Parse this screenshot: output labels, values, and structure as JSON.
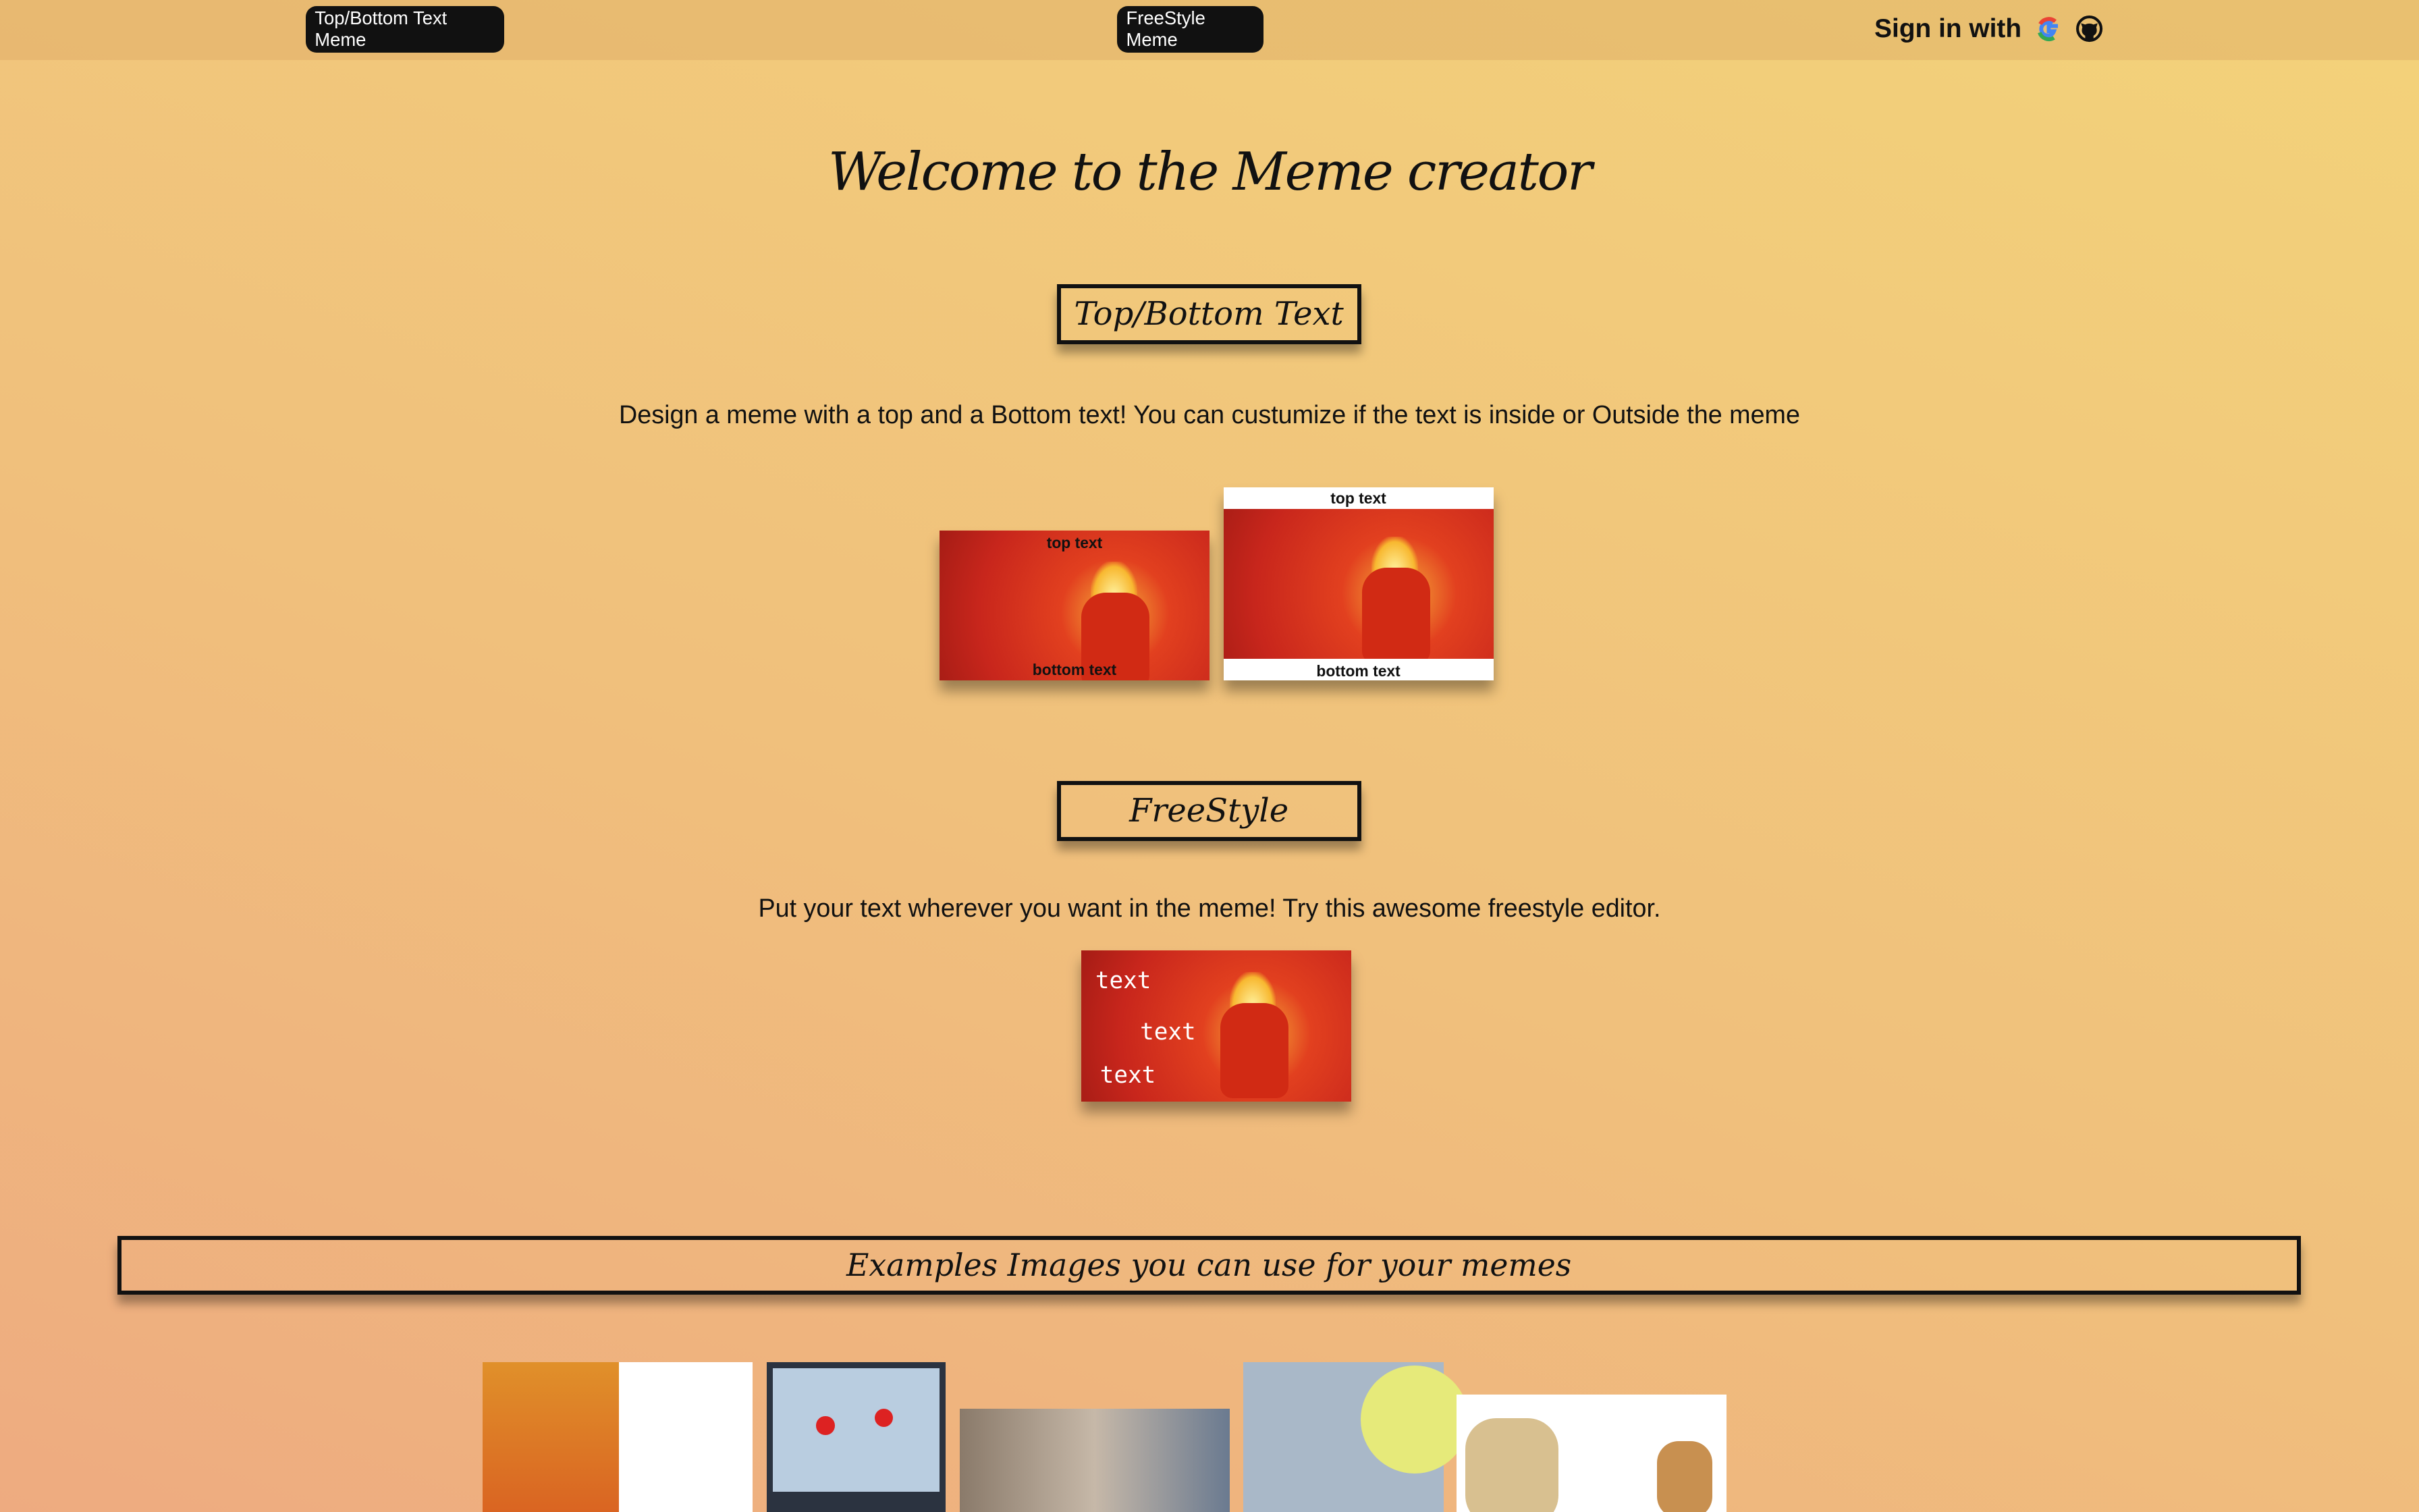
{
  "nav": {
    "top_bottom_button": "Top/Bottom Text Meme",
    "freestyle_button": "FreeStyle Meme",
    "sign_in_label": "Sign in with",
    "google_icon": "google-icon",
    "github_icon": "github-icon"
  },
  "main": {
    "title": "Welcome to the Meme creator",
    "top_bottom": {
      "heading": "Top/Bottom Text",
      "description": "Design a meme with a top and a Bottom text! You can custumize if the text is inside or Outside the meme",
      "top_text": "top text",
      "bottom_text": "bottom text"
    },
    "freestyle": {
      "heading": "FreeStyle",
      "description": "Put your text wherever you want in the meme! Try this awesome freestyle editor.",
      "texts": [
        "text",
        "text",
        "text"
      ]
    },
    "examples": {
      "heading": "Examples Images you can use for your memes"
    }
  },
  "colors": {
    "background_start": "#eeab80",
    "background_end": "#f3d27a",
    "button": "#111111",
    "meme_red": "#c8261c"
  }
}
